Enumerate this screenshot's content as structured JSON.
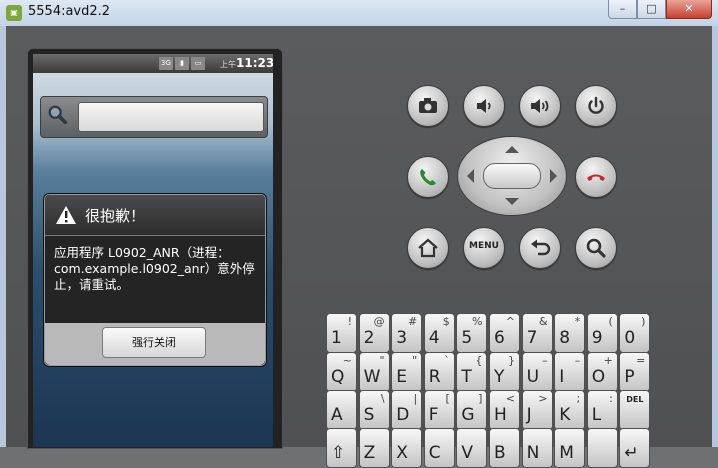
{
  "window": {
    "title": "5554:avd2.2",
    "controls": {
      "minimize": "–",
      "maximize": "□",
      "close": "✕"
    }
  },
  "statusbar": {
    "am_pm": "上午",
    "time": "11:23",
    "signal_label": "3G"
  },
  "dialog": {
    "title": "很抱歉！",
    "message": "应用程序 L0902_ANR（进程：com.example.l0902_anr）意外停止，请重试。",
    "button": "强行关闭"
  },
  "controls": {
    "menu_label": "MENU"
  },
  "keyboard": {
    "rows": [
      [
        {
          "m": "1",
          "a": "!"
        },
        {
          "m": "2",
          "a": "@"
        },
        {
          "m": "3",
          "a": "#"
        },
        {
          "m": "4",
          "a": "$"
        },
        {
          "m": "5",
          "a": "%"
        },
        {
          "m": "6",
          "a": "^"
        },
        {
          "m": "7",
          "a": "&"
        },
        {
          "m": "8",
          "a": "*"
        },
        {
          "m": "9",
          "a": "("
        },
        {
          "m": "0",
          "a": ")"
        }
      ],
      [
        {
          "m": "Q",
          "a": "~"
        },
        {
          "m": "W",
          "a": "\""
        },
        {
          "m": "E",
          "a": "\""
        },
        {
          "m": "R",
          "a": "`"
        },
        {
          "m": "T",
          "a": "{"
        },
        {
          "m": "Y",
          "a": "}"
        },
        {
          "m": "U",
          "a": "–"
        },
        {
          "m": "I",
          "a": "–"
        },
        {
          "m": "O",
          "a": "+"
        },
        {
          "m": "P",
          "a": "="
        }
      ],
      [
        {
          "m": "A",
          "a": ""
        },
        {
          "m": "S",
          "a": "\\"
        },
        {
          "m": "D",
          "a": "|"
        },
        {
          "m": "F",
          "a": "["
        },
        {
          "m": "G",
          "a": "]"
        },
        {
          "m": "H",
          "a": "<"
        },
        {
          "m": "J",
          "a": ">"
        },
        {
          "m": "K",
          "a": ";"
        },
        {
          "m": "L",
          "a": ":"
        },
        {
          "m": "",
          "a": "",
          "del": "DEL"
        }
      ],
      [
        {
          "m": "⇧",
          "a": ""
        },
        {
          "m": "Z",
          "a": ""
        },
        {
          "m": "X",
          "a": ""
        },
        {
          "m": "C",
          "a": ""
        },
        {
          "m": "V",
          "a": ""
        },
        {
          "m": "B",
          "a": ""
        },
        {
          "m": "N",
          "a": ""
        },
        {
          "m": "M",
          "a": ""
        },
        {
          "m": "",
          "a": ""
        },
        {
          "m": "↵",
          "a": ""
        }
      ]
    ]
  }
}
